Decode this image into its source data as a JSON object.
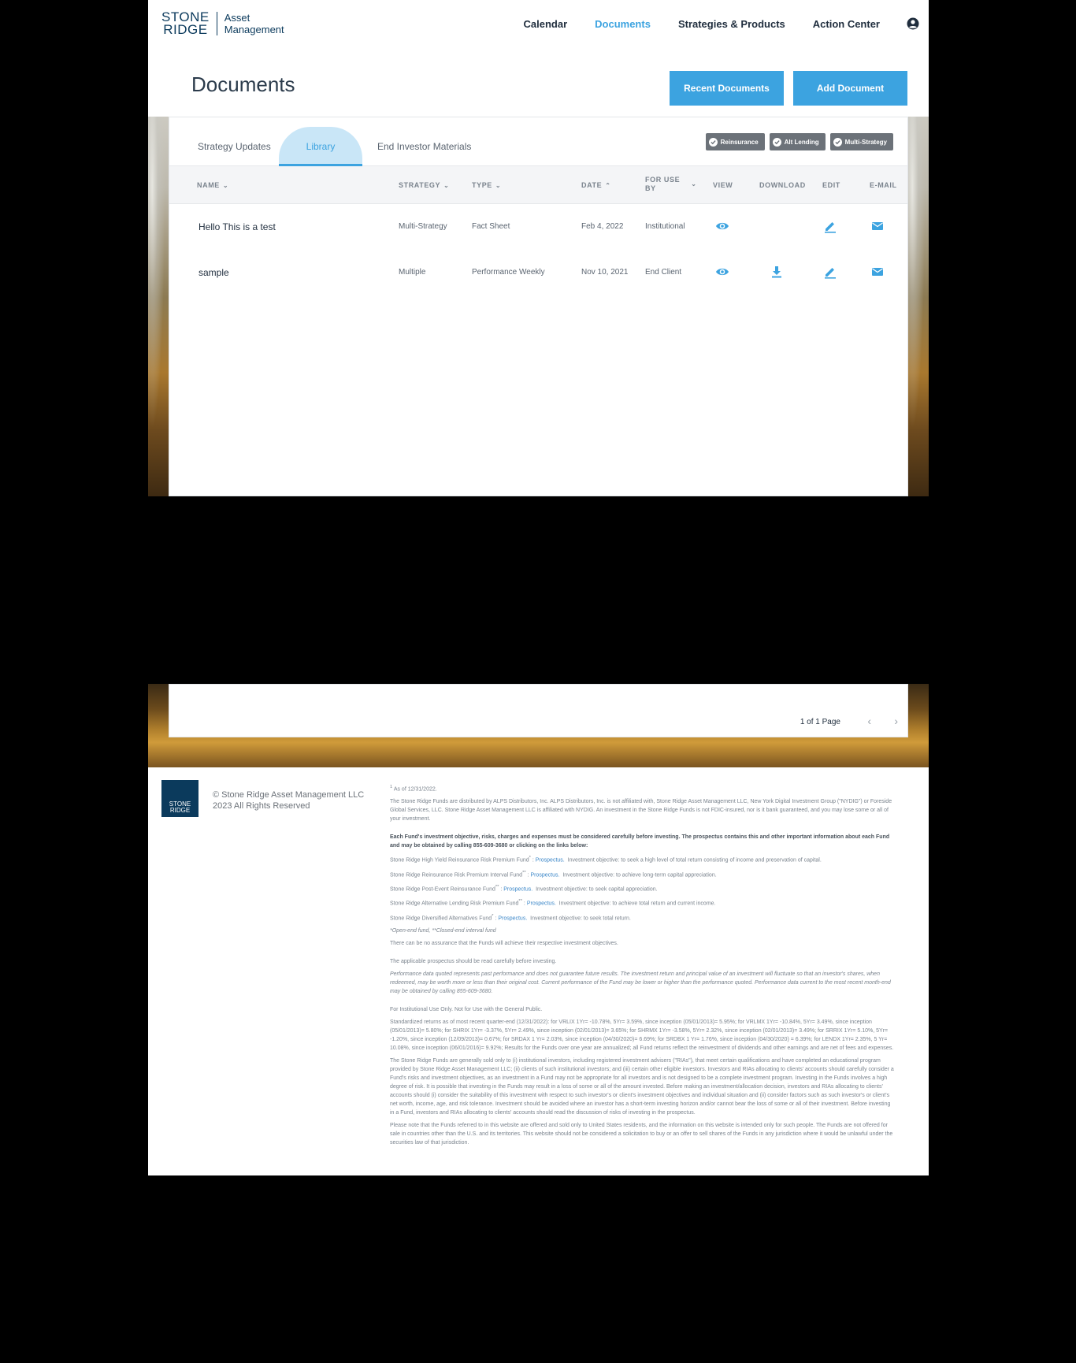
{
  "brand": {
    "line1": "STONE",
    "line2": "RIDGE",
    "sub1": "Asset",
    "sub2": "Management"
  },
  "nav": {
    "calendar": "Calendar",
    "documents": "Documents",
    "strategies": "Strategies & Products",
    "action_center": "Action Center"
  },
  "page": {
    "title": "Documents",
    "recent_button": "Recent Documents",
    "add_button": "Add Document"
  },
  "tabs": {
    "strategy_updates": "Strategy Updates",
    "library": "Library",
    "end_investor": "End Investor Materials"
  },
  "chips": [
    "Reinsurance",
    "Alt Lending",
    "Multi-Strategy"
  ],
  "table": {
    "headers": {
      "name": "NAME",
      "strategy": "STRATEGY",
      "type": "TYPE",
      "date": "DATE",
      "foruse1": "FOR USE",
      "foruse2": "BY",
      "view": "VIEW",
      "download": "DOWNLOAD",
      "edit": "EDIT",
      "email": "E-MAIL"
    },
    "rows": [
      {
        "name": "Hello This is a test",
        "strategy": "Multi-Strategy",
        "type": "Fact Sheet",
        "date": "Feb 4, 2022",
        "for_use": "Institutional"
      },
      {
        "name": "sample",
        "strategy": "Multiple",
        "type": "Performance Weekly",
        "date": "Nov 10, 2021",
        "for_use": "End Client"
      }
    ]
  },
  "pager": {
    "text": "1 of 1 Page"
  },
  "footer": {
    "logo1": "STONE",
    "logo2": "RIDGE",
    "copyright": "© Stone Ridge Asset Management LLC 2023 All Rights Reserved",
    "asof": "As of 12/31/2022.",
    "p1": "The Stone Ridge Funds are distributed by ALPS Distributors, Inc. ALPS Distributors, Inc. is not affiliated with, Stone Ridge Asset Management LLC, New York Digital Investment Group (\"NYDIG\") or Foreside Global Services, LLC. Stone Ridge Asset Management LLC is affiliated with NYDIG. An investment in the Stone Ridge Funds is not FDIC-insured, nor is it bank guaranteed, and you may lose some or all of your investment.",
    "p2": "Each Fund's investment objective, risks, charges and expenses must be considered carefully before investing. The prospectus contains this and other important information about each Fund and may be obtained by calling 855-609-3680 or clicking on the links below:",
    "funds": [
      {
        "name": "Stone Ridge High Yield Reinsurance Risk Premium Fund",
        "mark": "*",
        "link": "Prospectus.",
        "obj": "Investment objective: to seek a high level of total return consisting of income and preservation of capital."
      },
      {
        "name": "Stone Ridge Reinsurance Risk Premium Interval Fund",
        "mark": "**",
        "link": "Prospectus.",
        "obj": "Investment objective: to achieve long-term capital appreciation."
      },
      {
        "name": "Stone Ridge Post-Event Reinsurance Fund",
        "mark": "**",
        "link": "Prospectus.",
        "obj": "Investment objective: to seek capital appreciation."
      },
      {
        "name": "Stone Ridge Alternative Lending Risk Premium Fund",
        "mark": "**",
        "link": "Prospectus.",
        "obj": "Investment objective: to achieve total return and current income."
      },
      {
        "name": "Stone Ridge Diversified Alternatives Fund",
        "mark": "*",
        "link": "Prospectus.",
        "obj": "Investment objective: to seek total return."
      }
    ],
    "fundtypes": "*Open-end fund, **Closed-end interval fund",
    "p3": "There can be no assurance that the Funds will achieve their respective investment objectives.",
    "p4": "The applicable prospectus should be read carefully before investing.",
    "p5": "Performance data quoted represents past performance and does not guarantee future results. The investment return and principal value of an investment will fluctuate so that an investor's shares, when redeemed, may be worth more or less than their original cost. Current performance of the Fund may be lower or higher than the performance quoted. Performance data current to the most recent month-end may be obtained by calling 855-609-3680.",
    "p6": "For Institutional Use Only. Not for Use with the General Public.",
    "p7": "Standardized returns as of most recent quarter-end (12/31/2022): for VRLIX 1Yr= -10.78%, 5Yr= 3.59%, since inception (05/01/2013)= 5.95%; for VRLMX 1Yr= -10.84%, 5Yr= 3.49%, since inception (05/01/2013)= 5.80%; for SHRIX 1Yr= -3.37%, 5Yr= 2.49%, since inception (02/01/2013)= 3.65%; for SHRMX 1Yr= -3.58%, 5Yr= 2.32%, since inception (02/01/2013)= 3.49%; for SRRIX 1Yr= 5.10%, 5Yr= -1.20%, since inception (12/09/2013)= 0.67%; for SRDAX 1 Yr= 2.03%, since inception (04/30/2020)= 6.69%; for SRDBX 1 Yr= 1.76%, since inception (04/30/2020) = 6.39%; for LENDX 1Yr= 2.35%, 5 Yr= 10.08%, since inception (06/01/2016)= 9.92%; Results for the Funds over one year are annualized; all Fund returns reflect the reinvestment of dividends and other earnings and are net of fees and expenses.",
    "p8": "The Stone Ridge Funds are generally sold only to (i) institutional investors, including registered investment advisers (\"RIAs\"), that meet certain qualifications and have completed an educational program provided by Stone Ridge Asset Management LLC; (ii) clients of such institutional investors; and (iii) certain other eligible investors. Investors and RIAs allocating to clients' accounts should carefully consider a Fund's risks and investment objectives, as an investment in a Fund may not be appropriate for all investors and is not designed to be a complete investment program. Investing in the Funds involves a high degree of risk. It is possible that investing in the Funds may result in a loss of some or all of the amount invested. Before making an investment/allocation decision, investors and RIAs allocating to clients' accounts should (i) consider the suitability of this investment with respect to such investor's or client's investment objectives and individual situation and (ii) consider factors such as such investor's or client's net worth, income, age, and risk tolerance. Investment should be avoided where an investor has a short-term investing horizon and/or cannot bear the loss of some or all of their investment. Before investing in a Fund, investors and RIAs allocating to clients' accounts should read the discussion of risks of investing in the prospectus.",
    "p9": "Please note that the Funds referred to in this website are offered and sold only to United States residents, and the information on this website is intended only for such people. The Funds are not offered for sale in countries other than the U.S. and its territories. This website should not be considered a solicitation to buy or an offer to sell shares of the Funds in any jurisdiction where it would be unlawful under the securities law of that jurisdiction."
  },
  "colors": {
    "accent": "#3ca3e0",
    "navy": "#0b3a5c",
    "chip": "#6c7279"
  }
}
